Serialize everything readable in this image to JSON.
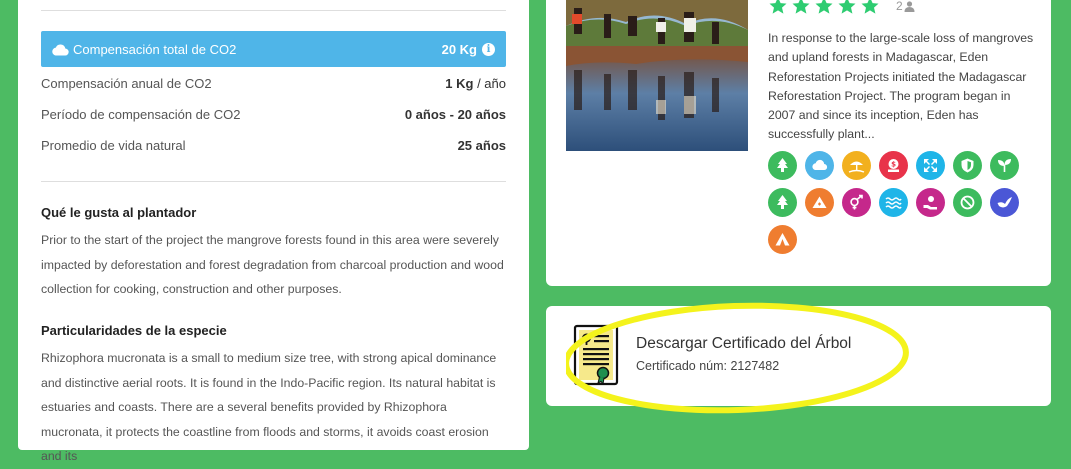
{
  "co2": {
    "total_label": "Compensación total de CO2",
    "total_value": "20 Kg",
    "stats": [
      {
        "label": "Compensación anual de CO2",
        "value_bold": "1 Kg",
        "value_rest": " / año"
      },
      {
        "label": "Período de compensación de CO2",
        "value_bold": "0 años - 20 años",
        "value_rest": ""
      },
      {
        "label": "Promedio de vida natural",
        "value_bold": "25 años",
        "value_rest": ""
      }
    ]
  },
  "planter": {
    "title": "Qué le gusta al plantador",
    "text": "Prior to the start of the project the mangrove forests found in this area were severely impacted by deforestation and forest degradation from charcoal production and wood collection for cooking, construction and other purposes."
  },
  "species": {
    "title": "Particularidades de la especie",
    "text": "Rhizophora mucronata is a small to medium size tree, with strong apical dominance and distinctive aerial roots. It is found in the Indo-Pacific region. Its natural habitat is estuaries and coasts. There are a several benefits provided by Rhizophora mucronata, it protects the coastline from floods and storms, it avoids coast erosion and its"
  },
  "project": {
    "rating_stars": 5,
    "rating_count": "2",
    "description": "In response to the large-scale loss of mangroves and upland forests in Madagascar, Eden Reforestation Projects initiated the Madagascar Reforestation Project. The program began in 2007 and since its inception, Eden has successfully plant...",
    "colors": {
      "star": "#2ecc71",
      "green": "#4dbb63",
      "blue_bar": "#4fb5e8"
    },
    "sdg_icons": [
      {
        "name": "tree-icon",
        "color": "#3dbb5e"
      },
      {
        "name": "cloud-icon",
        "color": "#4fb5e8"
      },
      {
        "name": "beach-icon",
        "color": "#f2b01e"
      },
      {
        "name": "money-bag-icon",
        "color": "#e8334a"
      },
      {
        "name": "expand-icon",
        "color": "#1fb5e8"
      },
      {
        "name": "shield-icon",
        "color": "#3dbb5e"
      },
      {
        "name": "sprout-icon",
        "color": "#3dbb5e"
      },
      {
        "name": "tree-icon",
        "color": "#3dbb5e"
      },
      {
        "name": "mountain-icon",
        "color": "#ef7d30"
      },
      {
        "name": "gender-icon",
        "color": "#c5288b"
      },
      {
        "name": "water-waves-icon",
        "color": "#1fb5e8"
      },
      {
        "name": "hand-money-icon",
        "color": "#c5288b"
      },
      {
        "name": "no-sign-icon",
        "color": "#3dbb5e"
      },
      {
        "name": "bird-icon",
        "color": "#4b57d6"
      },
      {
        "name": "tent-icon",
        "color": "#ef7d30"
      }
    ]
  },
  "certificate": {
    "title": "Descargar Certificado del Árbol",
    "number_label": "Certificado núm: 2127482"
  }
}
